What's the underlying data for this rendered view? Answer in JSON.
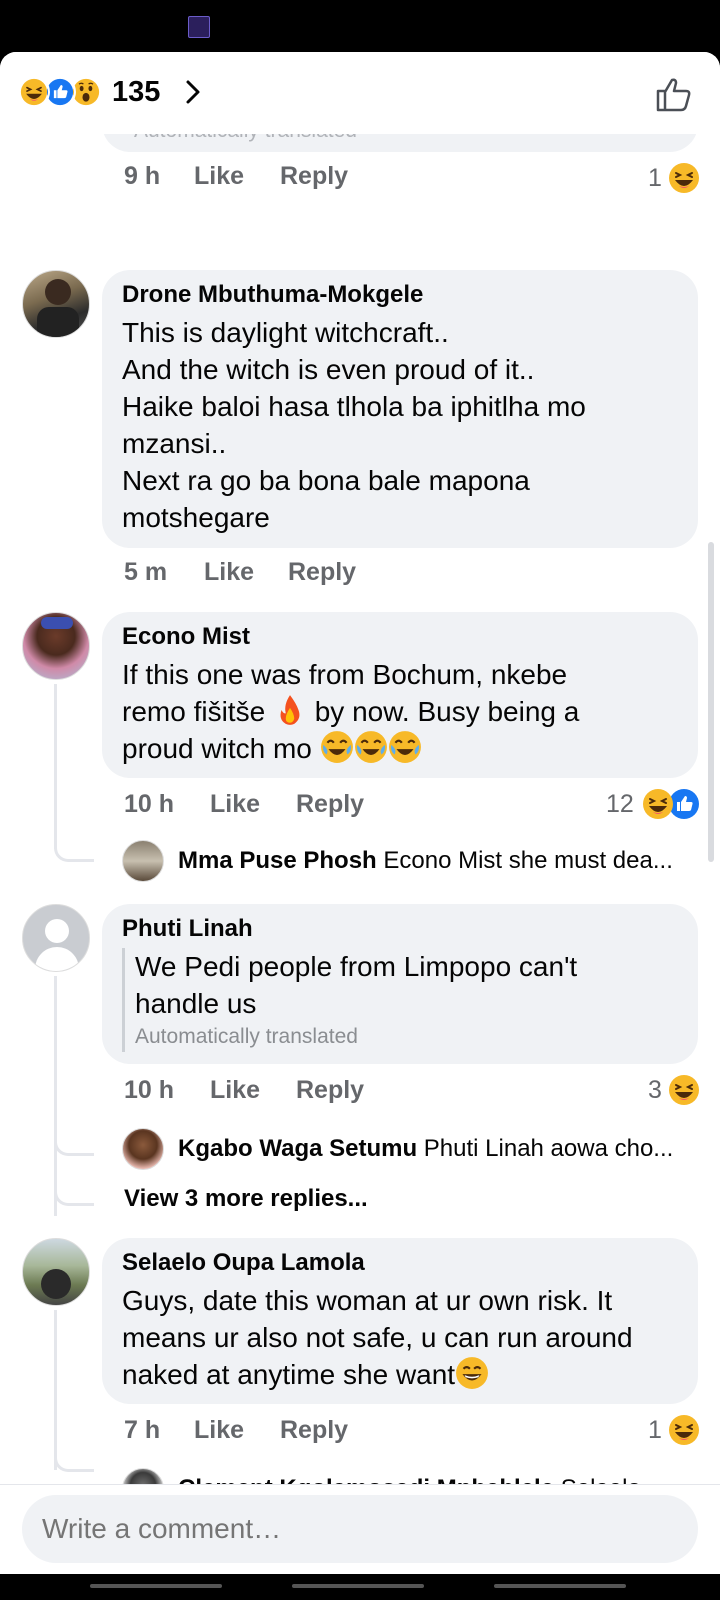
{
  "reactions": {
    "count": "135",
    "emoji": [
      "haha",
      "like",
      "wow"
    ]
  },
  "top_comment_tail": {
    "faded_text": "Automatically translated",
    "time": "9 h",
    "like": "Like",
    "reply": "Reply",
    "reaction_count": "1"
  },
  "comments": [
    {
      "name": "Drone Mbuthuma-Mokgele",
      "lines": [
        "This is daylight witchcraft..",
        "And the witch is even proud of it..",
        "Haike baloi hasa tlhola ba iphitlha mo",
        "mzansi..",
        "Next ra go ba bona bale mapona",
        "motshegare"
      ],
      "time": "5 m",
      "like": "Like",
      "reply": "Reply"
    },
    {
      "name": "Econo Mist",
      "line1": "If this one was from Bochum, nkebe",
      "line2a": "remo fišitše",
      "line2b": "by now. Busy being a",
      "line3": "proud witch mo",
      "time": "10 h",
      "like": "Like",
      "reply": "Reply",
      "reaction_count": "12",
      "reply_preview": {
        "name": "Mma Puse Phosh",
        "text": "Econo Mist she must dea..."
      }
    },
    {
      "name": "Phuti Linah",
      "lines": [
        "We Pedi people from Limpopo can't",
        "handle us"
      ],
      "auto_translated": "Automatically translated",
      "time": "10 h",
      "like": "Like",
      "reply": "Reply",
      "reaction_count": "3",
      "reply_preview": {
        "name": "Kgabo Waga Setumu",
        "text": "Phuti Linah aowa cho..."
      },
      "more_replies": "View 3 more replies..."
    },
    {
      "name": "Selaelo Oupa Lamola",
      "lines": [
        "Guys, date this woman at ur own risk. It",
        "means ur also not safe, u can run around",
        "naked at anytime she want"
      ],
      "time": "7 h",
      "like": "Like",
      "reply": "Reply",
      "reaction_count": "1",
      "reply_preview": {
        "name": "Clement Kgolamosadi Mphahlele",
        "text": "Selaelo..."
      }
    }
  ],
  "composer": {
    "placeholder": "Write a comment…"
  },
  "colors": {
    "bubble": "#f0f2f5",
    "meta": "#65676b",
    "like_blue": "#1877f2",
    "haha_yellow": "#f7b928"
  }
}
